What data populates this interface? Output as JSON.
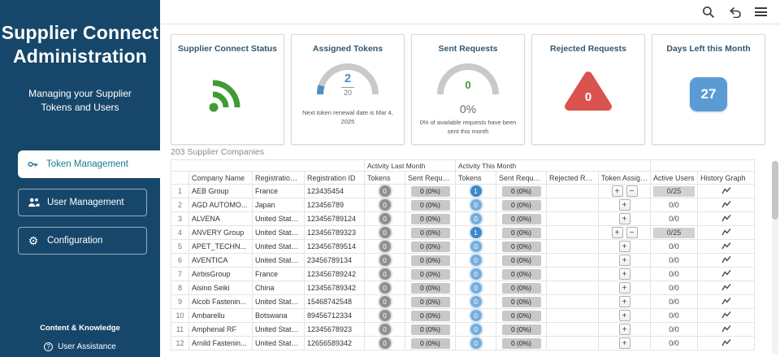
{
  "colors": {
    "sidebar_navy": "#16476b",
    "accent_teal": "#1a7b8d",
    "status_green": "#3f9c35",
    "gauge_blue": "#4a8fc7",
    "alert_red": "#d9534f",
    "days_blue": "#5b9bd5"
  },
  "sidebar": {
    "title": "Supplier Connect Administration",
    "subtitle": "Managing your Supplier Tokens and Users",
    "menu": [
      {
        "label": "Token Management",
        "icon": "key-icon",
        "active": true
      },
      {
        "label": "User Management",
        "icon": "users-icon",
        "active": false
      },
      {
        "label": "Configuration",
        "icon": "gear-icon",
        "active": false
      }
    ],
    "footer_title": "Content & Knowledge",
    "footer_link": "User Assistance",
    "footer_link_icon": "help-icon"
  },
  "topbar": {
    "icons": [
      {
        "name": "search-icon"
      },
      {
        "name": "undo-icon"
      },
      {
        "name": "menu-icon"
      }
    ]
  },
  "cards": [
    {
      "title": "Supplier Connect Status",
      "icon": "signal-status-icon"
    },
    {
      "title": "Assigned Tokens",
      "value": "2",
      "max": "20",
      "note": "Next token renewal date is Mar 4, 2025"
    },
    {
      "title": "Sent Requests",
      "value": "0",
      "percent": "0%",
      "note": "0% of available requests have been sent this month"
    },
    {
      "title": "Rejected Requests",
      "value": "0"
    },
    {
      "title": "Days Left this Month",
      "value": "27"
    }
  ],
  "table": {
    "caption": "203 Supplier Companies",
    "group_headers": [
      "Activity Last Month",
      "Activity This Month"
    ],
    "columns": [
      "Company Name",
      "Registration Lo...",
      "Registration ID",
      "Tokens",
      "Sent Requests",
      "Tokens",
      "Sent Requests",
      "Rejected Requ...",
      "Token Assignm...",
      "Active Users",
      "History Graph"
    ],
    "assign_buttons": {
      "plus": "+",
      "minus": "−"
    },
    "rows": [
      {
        "num": "1",
        "company": "AEB Group",
        "location": "France",
        "registration_id": "123435454",
        "tokens_last_month": "0",
        "sent_last_month": "0 (0%)",
        "tokens_this_month": "1",
        "sent_this_month": "0 (0%)",
        "rejected": "",
        "has_minus": true,
        "active_users": "0/25",
        "users_highlight": true
      },
      {
        "num": "2",
        "company": "AGD AUTOMO...",
        "location": "Japan",
        "registration_id": "123456789",
        "tokens_last_month": "0",
        "sent_last_month": "0 (0%)",
        "tokens_this_month": "0",
        "sent_this_month": "0 (0%)",
        "rejected": "",
        "has_minus": false,
        "active_users": "0/0",
        "users_highlight": false
      },
      {
        "num": "3",
        "company": "ALVENA",
        "location": "United States ...",
        "registration_id": "123456789124",
        "tokens_last_month": "0",
        "sent_last_month": "0 (0%)",
        "tokens_this_month": "0",
        "sent_this_month": "0 (0%)",
        "rejected": "",
        "has_minus": false,
        "active_users": "0/0",
        "users_highlight": false
      },
      {
        "num": "4",
        "company": "ANVERY Group",
        "location": "United States ...",
        "registration_id": "123456789323",
        "tokens_last_month": "0",
        "sent_last_month": "0 (0%)",
        "tokens_this_month": "1",
        "sent_this_month": "0 (0%)",
        "rejected": "",
        "has_minus": true,
        "active_users": "0/25",
        "users_highlight": true
      },
      {
        "num": "5",
        "company": "APET_TECHN...",
        "location": "United States ...",
        "registration_id": "123456789514",
        "tokens_last_month": "0",
        "sent_last_month": "0 (0%)",
        "tokens_this_month": "0",
        "sent_this_month": "0 (0%)",
        "rejected": "",
        "has_minus": false,
        "active_users": "0/0",
        "users_highlight": false
      },
      {
        "num": "6",
        "company": "AVENTICA",
        "location": "United States ...",
        "registration_id": "23456789134",
        "tokens_last_month": "0",
        "sent_last_month": "0 (0%)",
        "tokens_this_month": "0",
        "sent_this_month": "0 (0%)",
        "rejected": "",
        "has_minus": false,
        "active_users": "0/0",
        "users_highlight": false
      },
      {
        "num": "7",
        "company": "AirbisGroup",
        "location": "France",
        "registration_id": "123456789242",
        "tokens_last_month": "0",
        "sent_last_month": "0 (0%)",
        "tokens_this_month": "0",
        "sent_this_month": "0 (0%)",
        "rejected": "",
        "has_minus": false,
        "active_users": "0/0",
        "users_highlight": false
      },
      {
        "num": "8",
        "company": "Aisino Seiki",
        "location": "China",
        "registration_id": "123456789342",
        "tokens_last_month": "0",
        "sent_last_month": "0 (0%)",
        "tokens_this_month": "0",
        "sent_this_month": "0 (0%)",
        "rejected": "",
        "has_minus": false,
        "active_users": "0/0",
        "users_highlight": false
      },
      {
        "num": "9",
        "company": "Alcob Fastenin...",
        "location": "United States ...",
        "registration_id": "15468742548",
        "tokens_last_month": "0",
        "sent_last_month": "0 (0%)",
        "tokens_this_month": "0",
        "sent_this_month": "0 (0%)",
        "rejected": "",
        "has_minus": false,
        "active_users": "0/0",
        "users_highlight": false
      },
      {
        "num": "10",
        "company": "Ambarellu",
        "location": "Botswana",
        "registration_id": "89456712334",
        "tokens_last_month": "0",
        "sent_last_month": "0 (0%)",
        "tokens_this_month": "0",
        "sent_this_month": "0 (0%)",
        "rejected": "",
        "has_minus": false,
        "active_users": "0/0",
        "users_highlight": false
      },
      {
        "num": "11",
        "company": "Amphenal RF",
        "location": "United States ...",
        "registration_id": "12345678923",
        "tokens_last_month": "0",
        "sent_last_month": "0 (0%)",
        "tokens_this_month": "0",
        "sent_this_month": "0 (0%)",
        "rejected": "",
        "has_minus": false,
        "active_users": "0/0",
        "users_highlight": false
      },
      {
        "num": "12",
        "company": "Arnild Fastenin...",
        "location": "United States ...",
        "registration_id": "12656589342",
        "tokens_last_month": "0",
        "sent_last_month": "0 (0%)",
        "tokens_this_month": "0",
        "sent_this_month": "0 (0%)",
        "rejected": "",
        "has_minus": false,
        "active_users": "0/0",
        "users_highlight": false
      }
    ]
  }
}
